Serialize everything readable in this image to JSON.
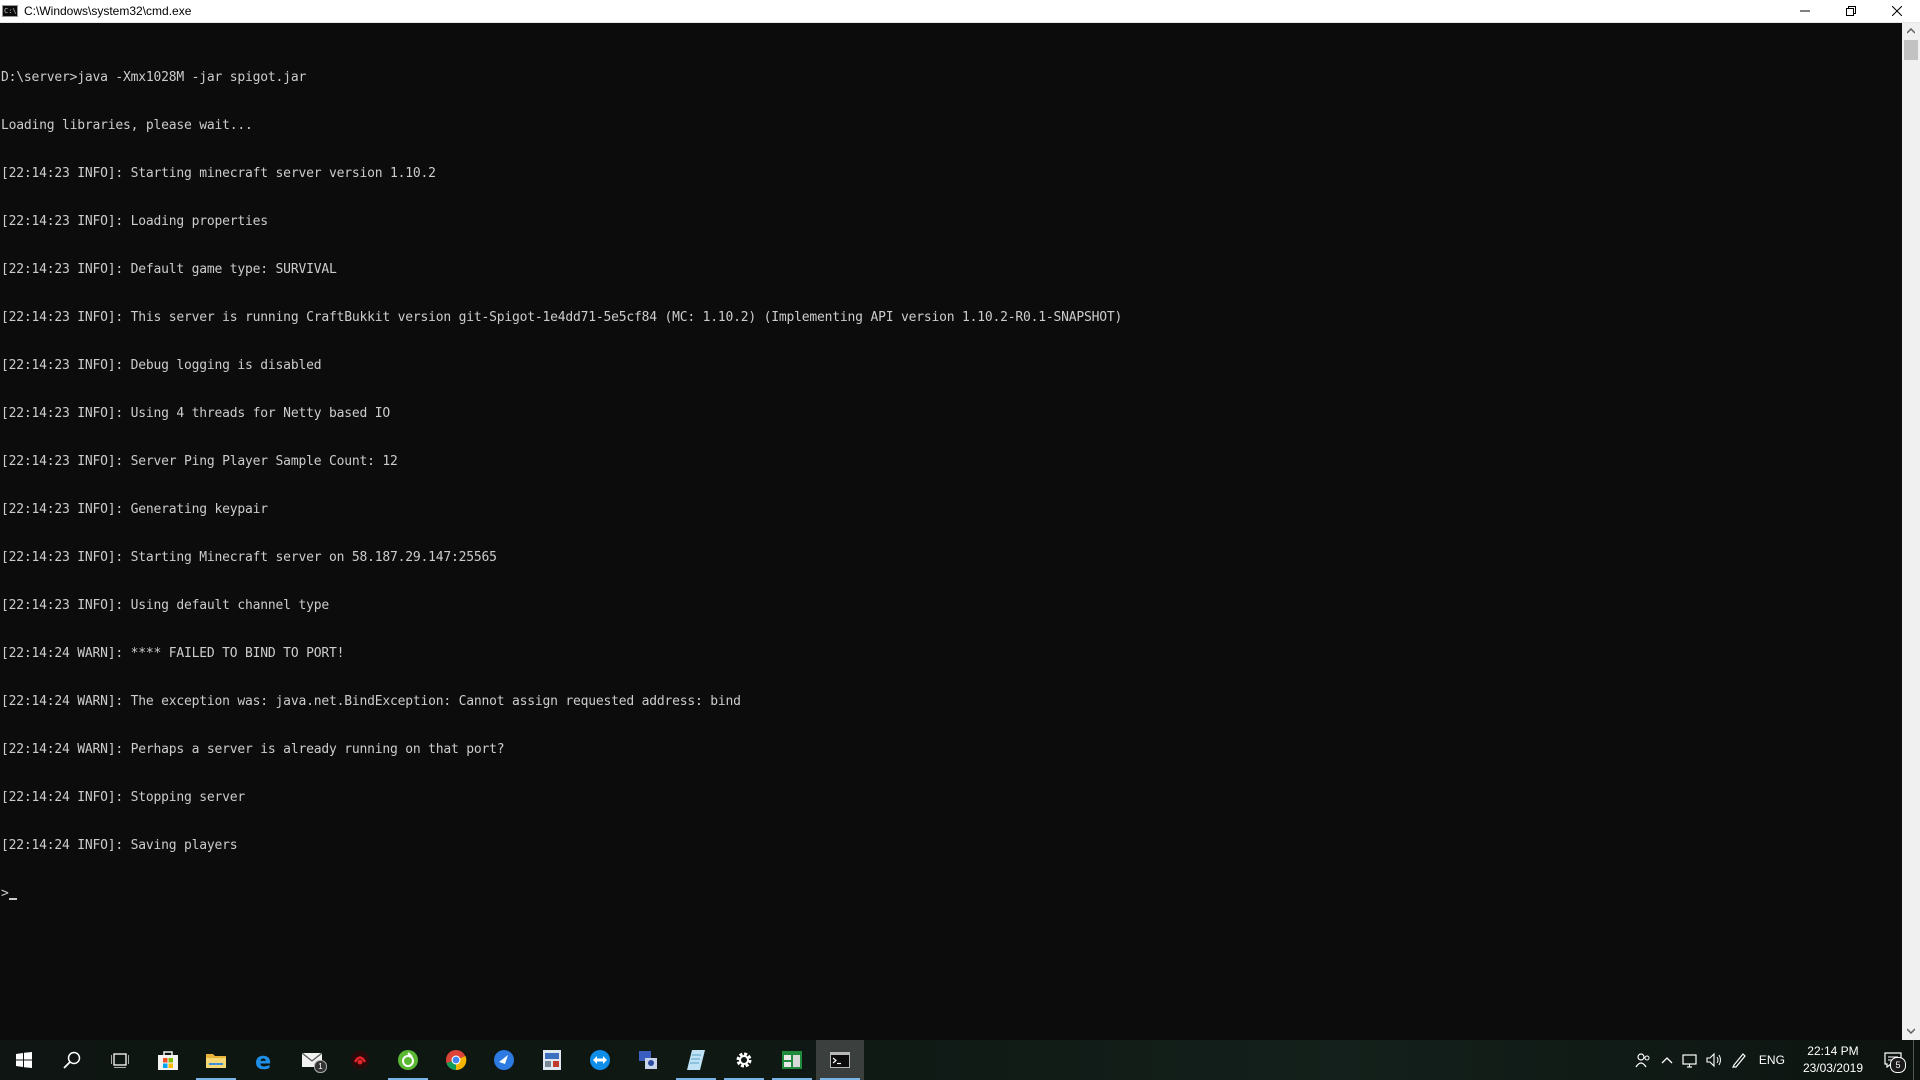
{
  "window": {
    "title": "C:\\Windows\\system32\\cmd.exe",
    "icon_glyph": "C:\\"
  },
  "console": {
    "lines": [
      "D:\\server>java -Xmx1028M -jar spigot.jar",
      "Loading libraries, please wait...",
      "[22:14:23 INFO]: Starting minecraft server version 1.10.2",
      "[22:14:23 INFO]: Loading properties",
      "[22:14:23 INFO]: Default game type: SURVIVAL",
      "[22:14:23 INFO]: This server is running CraftBukkit version git-Spigot-1e4dd71-5e5cf84 (MC: 1.10.2) (Implementing API version 1.10.2-R0.1-SNAPSHOT)",
      "[22:14:23 INFO]: Debug logging is disabled",
      "[22:14:23 INFO]: Using 4 threads for Netty based IO",
      "[22:14:23 INFO]: Server Ping Player Sample Count: 12",
      "[22:14:23 INFO]: Generating keypair",
      "[22:14:23 INFO]: Starting Minecraft server on 58.187.29.147:25565",
      "[22:14:23 INFO]: Using default channel type",
      "[22:14:24 WARN]: **** FAILED TO BIND TO PORT!",
      "[22:14:24 WARN]: The exception was: java.net.BindException: Cannot assign requested address: bind",
      "[22:14:24 WARN]: Perhaps a server is already running on that port?",
      "[22:14:24 INFO]: Stopping server",
      "[22:14:24 INFO]: Saving players"
    ],
    "prompt": ">"
  },
  "taskbar": {
    "items": [
      {
        "name": "start-icon"
      },
      {
        "name": "search-icon"
      },
      {
        "name": "task-view-icon"
      },
      {
        "name": "store-icon"
      },
      {
        "name": "file-explorer-icon"
      },
      {
        "name": "edge-icon"
      },
      {
        "name": "mail-icon",
        "badge": "1"
      },
      {
        "name": "game-app-icon"
      },
      {
        "name": "green-app-icon"
      },
      {
        "name": "chrome-icon"
      },
      {
        "name": "teamviewer-like-icon"
      },
      {
        "name": "system-tool-icon"
      },
      {
        "name": "remote-app-icon"
      },
      {
        "name": "network-tool-icon"
      },
      {
        "name": "notepad-icon"
      },
      {
        "name": "settings-icon"
      },
      {
        "name": "app-window-icon"
      },
      {
        "name": "cmd-icon"
      }
    ],
    "tray": {
      "language": "ENG",
      "time": "22:14 PM",
      "date": "23/03/2019",
      "notification_count": "5"
    }
  },
  "colors": {
    "console_bg": "#0c0c0c",
    "console_text": "#cccccc",
    "accent": "#78b4e6"
  }
}
